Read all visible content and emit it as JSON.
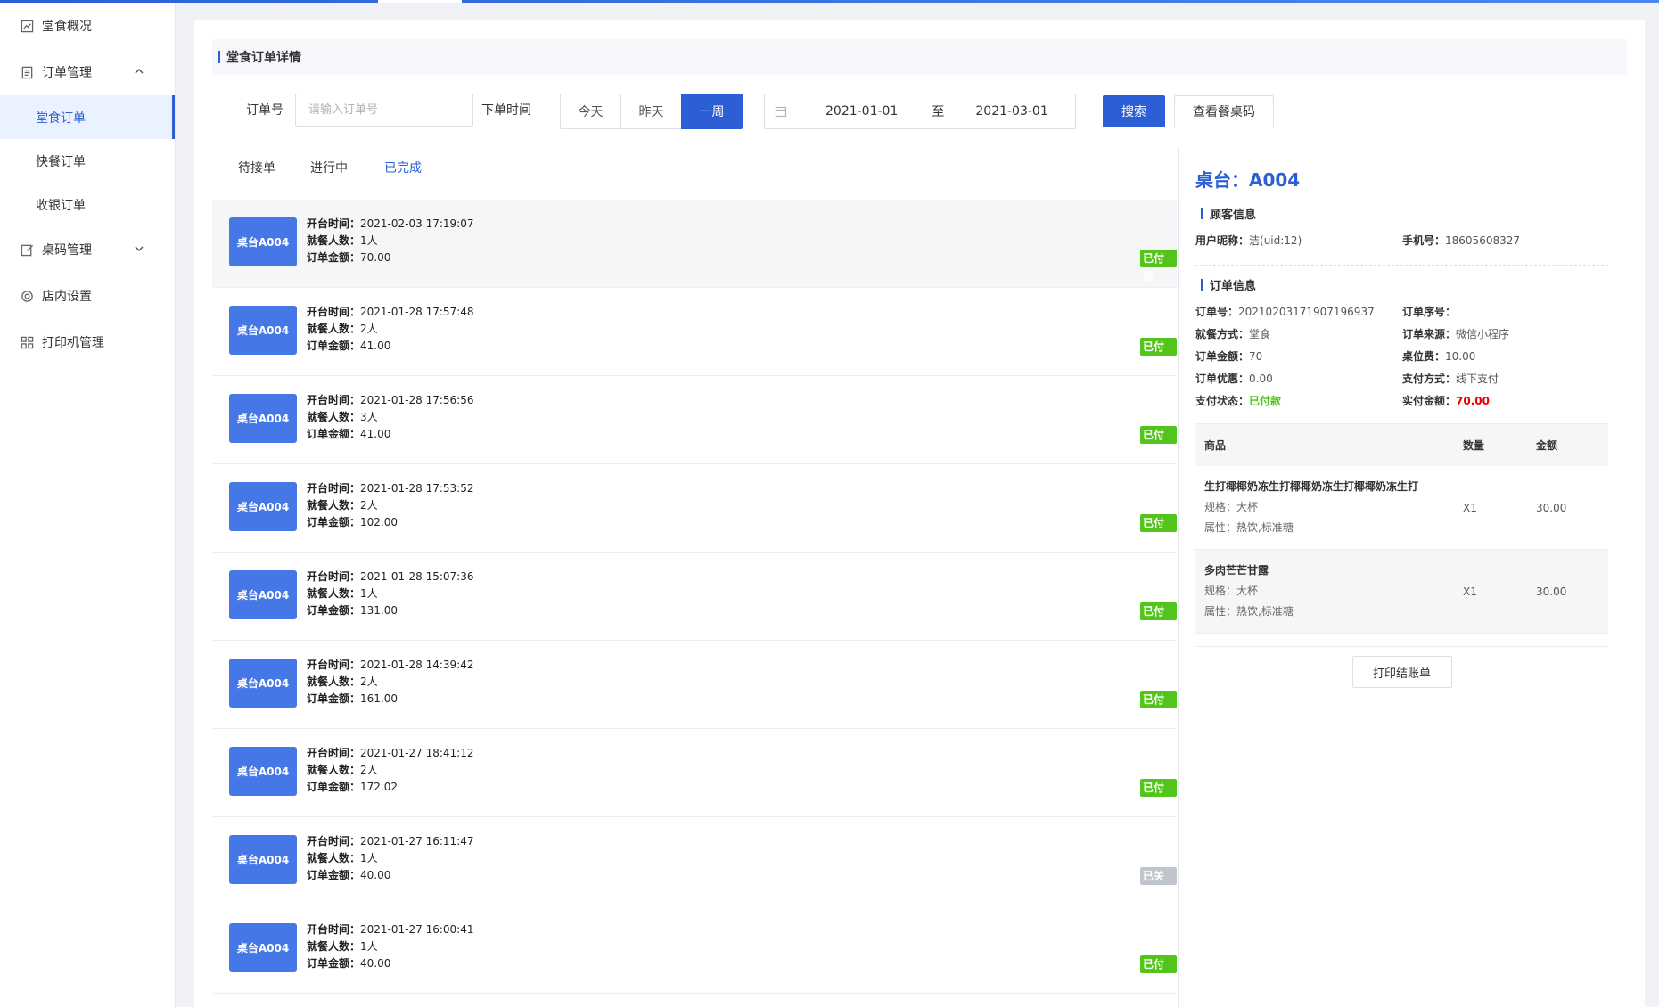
{
  "sidebar": {
    "items": [
      {
        "label": "堂食概况"
      },
      {
        "label": "订单管理"
      },
      {
        "label": "桌码管理"
      },
      {
        "label": "店内设置"
      },
      {
        "label": "打印机管理"
      }
    ],
    "order_sub": [
      {
        "label": "堂食订单",
        "active": true
      },
      {
        "label": "快餐订单"
      },
      {
        "label": "收银订单"
      }
    ]
  },
  "page": {
    "title": "堂食订单详情"
  },
  "filter": {
    "order_no_label": "订单号",
    "order_no_placeholder": "请输入订单号",
    "time_label": "下单时间",
    "ranges": [
      "今天",
      "昨天",
      "一周"
    ],
    "date_start": "2021-01-01",
    "date_sep": "至",
    "date_end": "2021-03-01",
    "search_label": "搜索",
    "view_code_label": "查看餐桌码"
  },
  "tabs": [
    "待接单",
    "进行中",
    "已完成"
  ],
  "order_fields": {
    "open_time": "开台时间：",
    "people": "就餐人数：",
    "amount": "订单金额："
  },
  "orders": [
    {
      "table": "桌台A004",
      "open_time": "2021-02-03 17:19:07",
      "people": "1人",
      "amount": "70.00",
      "status": "已付款"
    },
    {
      "table": "桌台A004",
      "open_time": "2021-01-28 17:57:48",
      "people": "2人",
      "amount": "41.00",
      "status": "已付款"
    },
    {
      "table": "桌台A004",
      "open_time": "2021-01-28 17:56:56",
      "people": "3人",
      "amount": "41.00",
      "status": "已付款"
    },
    {
      "table": "桌台A004",
      "open_time": "2021-01-28 17:53:52",
      "people": "2人",
      "amount": "102.00",
      "status": "已付款"
    },
    {
      "table": "桌台A004",
      "open_time": "2021-01-28 15:07:36",
      "people": "1人",
      "amount": "131.00",
      "status": "已付款"
    },
    {
      "table": "桌台A004",
      "open_time": "2021-01-28 14:39:42",
      "people": "2人",
      "amount": "161.00",
      "status": "已付款"
    },
    {
      "table": "桌台A004",
      "open_time": "2021-01-27 18:41:12",
      "people": "2人",
      "amount": "172.02",
      "status": "已付款"
    },
    {
      "table": "桌台A004",
      "open_time": "2021-01-27 16:11:47",
      "people": "1人",
      "amount": "40.00",
      "status": "已关闭"
    },
    {
      "table": "桌台A004",
      "open_time": "2021-01-27 16:00:41",
      "people": "1人",
      "amount": "40.00",
      "status": "已付款"
    }
  ],
  "detail": {
    "title": "桌台：A004",
    "customer_section": "顾客信息",
    "nickname_label": "用户昵称：",
    "nickname": "洁(uid:12)",
    "phone_label": "手机号：",
    "phone": "18605608327",
    "order_section": "订单信息",
    "order_no_label": "订单号：",
    "order_no": "20210203171907196937",
    "order_seq_label": "订单序号：",
    "order_seq": "",
    "dine_label": "就餐方式：",
    "dine": "堂食",
    "source_label": "订单来源：",
    "source": "微信小程序",
    "amount_label": "订单金额：",
    "amount": "70",
    "seat_fee_label": "桌位费：",
    "seat_fee": "10.00",
    "discount_label": "订单优惠：",
    "discount": "0.00",
    "pay_method_label": "支付方式：",
    "pay_method": "线下支付",
    "pay_status_label": "支付状态：",
    "pay_status": "已付款",
    "paid_amount_label": "实付金额：",
    "paid_amount": "70.00",
    "goods_headers": [
      "商品",
      "数量",
      "金额"
    ],
    "goods": [
      {
        "name": "生打椰椰奶冻生打椰椰奶冻生打椰椰奶冻生打",
        "spec": "规格：大杯",
        "attr": "属性：热饮,标准糖",
        "qty": "X1",
        "amount": "30.00"
      },
      {
        "name": "多肉芒芒甘露",
        "spec": "规格：大杯",
        "attr": "属性：热饮,标准糖",
        "qty": "X1",
        "amount": "30.00"
      }
    ],
    "print_label": "打印结账单"
  }
}
